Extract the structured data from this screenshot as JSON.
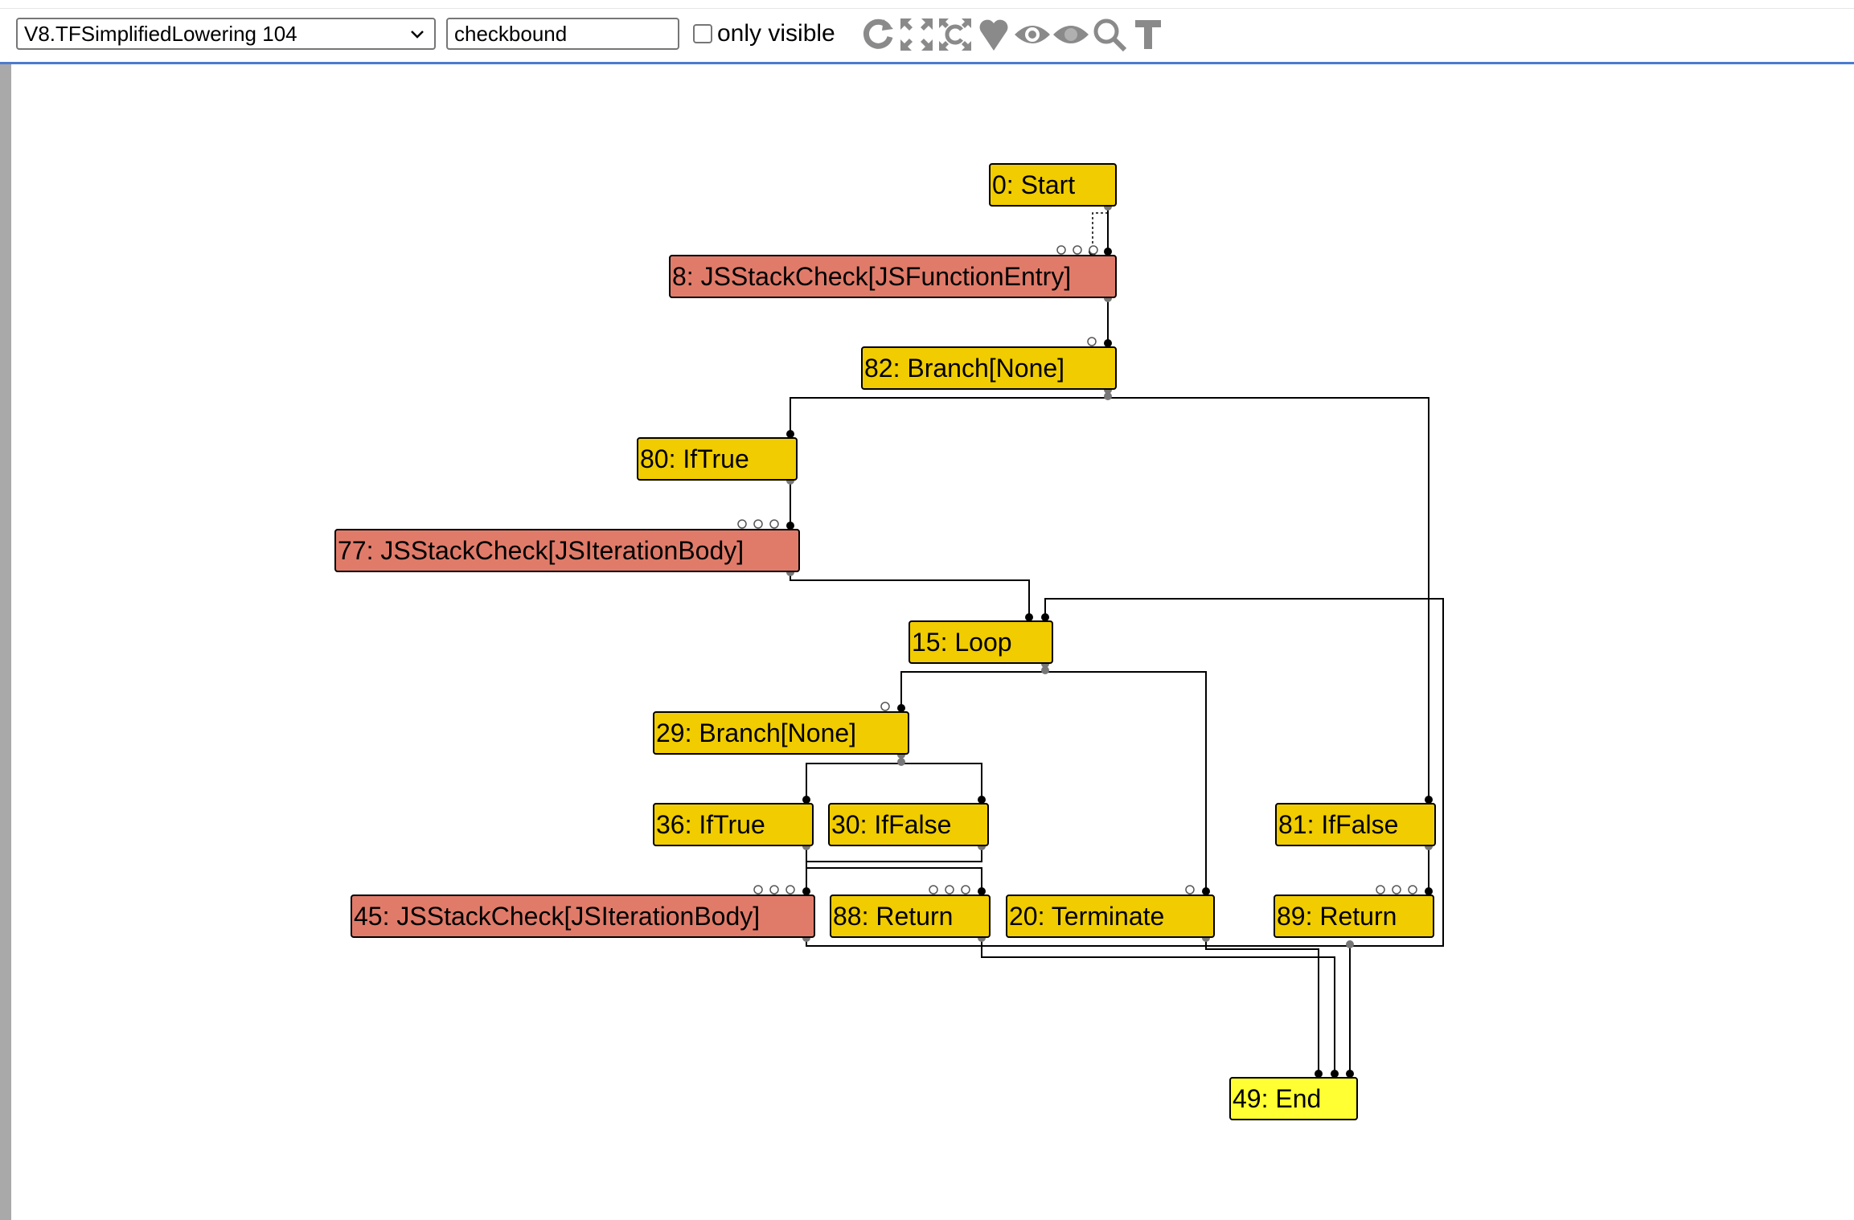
{
  "toolbar": {
    "phase_select": "V8.TFSimplifiedLowering 104",
    "search_value": "checkbound",
    "only_visible_label": "only visible",
    "only_visible_checked": false,
    "icons": [
      "refresh-icon",
      "expand-icon",
      "layout-icon",
      "heart-icon",
      "eye-outline-icon",
      "eye-filled-icon",
      "search-icon",
      "text-t-icon"
    ]
  },
  "colors": {
    "control_node": "#f0cc00",
    "stack_check_node": "#e07b6a",
    "end_node": "#ffff33",
    "edge": "#000000"
  },
  "graph": {
    "nodes": [
      {
        "id": "0",
        "label": "0: Start",
        "kind": "control"
      },
      {
        "id": "8",
        "label": "8: JSStackCheck[JSFunctionEntry]",
        "kind": "stack_check"
      },
      {
        "id": "82",
        "label": "82: Branch[None]",
        "kind": "control"
      },
      {
        "id": "80",
        "label": "80: IfTrue",
        "kind": "control"
      },
      {
        "id": "77",
        "label": "77: JSStackCheck[JSIterationBody]",
        "kind": "stack_check"
      },
      {
        "id": "15",
        "label": "15: Loop",
        "kind": "control"
      },
      {
        "id": "29",
        "label": "29: Branch[None]",
        "kind": "control"
      },
      {
        "id": "36",
        "label": "36: IfTrue",
        "kind": "control"
      },
      {
        "id": "30",
        "label": "30: IfFalse",
        "kind": "control"
      },
      {
        "id": "81",
        "label": "81: IfFalse",
        "kind": "control"
      },
      {
        "id": "45",
        "label": "45: JSStackCheck[JSIterationBody]",
        "kind": "stack_check"
      },
      {
        "id": "88",
        "label": "88: Return",
        "kind": "control"
      },
      {
        "id": "20",
        "label": "20: Terminate",
        "kind": "control"
      },
      {
        "id": "89",
        "label": "89: Return",
        "kind": "control"
      },
      {
        "id": "49",
        "label": "49: End",
        "kind": "end"
      }
    ],
    "edges": [
      [
        "0",
        "8"
      ],
      [
        "8",
        "82"
      ],
      [
        "82",
        "80"
      ],
      [
        "82",
        "81"
      ],
      [
        "80",
        "77"
      ],
      [
        "77",
        "15"
      ],
      [
        "45",
        "15"
      ],
      [
        "15",
        "29"
      ],
      [
        "15",
        "20"
      ],
      [
        "29",
        "36"
      ],
      [
        "29",
        "30"
      ],
      [
        "36",
        "45"
      ],
      [
        "30",
        "88"
      ],
      [
        "81",
        "89"
      ],
      [
        "88",
        "49"
      ],
      [
        "20",
        "49"
      ],
      [
        "89",
        "49"
      ]
    ]
  }
}
